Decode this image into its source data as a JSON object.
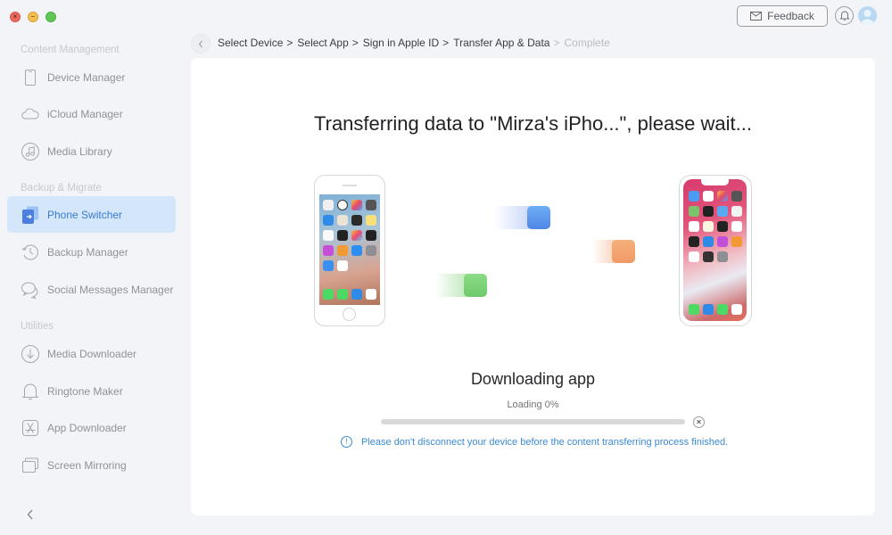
{
  "window": {
    "controls": [
      "close",
      "minimize",
      "maximize"
    ]
  },
  "header": {
    "feedback_label": "Feedback",
    "feedback_icon": "mail-icon",
    "notifications_icon": "bell-icon",
    "avatar_icon": "user-avatar-icon"
  },
  "sidebar": {
    "sections": [
      {
        "label": "Content Management",
        "items": [
          {
            "label": "Device Manager",
            "icon": "phone-icon",
            "active": false
          },
          {
            "label": "iCloud Manager",
            "icon": "cloud-icon",
            "active": false
          },
          {
            "label": "Media Library",
            "icon": "music-note-icon",
            "active": false
          }
        ]
      },
      {
        "label": "Backup & Migrate",
        "items": [
          {
            "label": "Phone Switcher",
            "icon": "phone-switch-icon",
            "active": true
          },
          {
            "label": "Backup Manager",
            "icon": "history-icon",
            "active": false
          },
          {
            "label": "Social Messages Manager",
            "icon": "chat-bubbles-icon",
            "active": false
          }
        ]
      },
      {
        "label": "Utilities",
        "items": [
          {
            "label": "Media Downloader",
            "icon": "download-circle-icon",
            "active": false
          },
          {
            "label": "Ringtone Maker",
            "icon": "bell-icon",
            "active": false
          },
          {
            "label": "App Downloader",
            "icon": "app-store-icon",
            "active": false
          },
          {
            "label": "Screen Mirroring",
            "icon": "screens-icon",
            "active": false
          }
        ]
      }
    ],
    "collapse_icon": "chevron-left-icon"
  },
  "breadcrumb": {
    "back_icon": "chevron-left-icon",
    "steps": [
      {
        "label": "Select Device",
        "done": true
      },
      {
        "label": "Select App",
        "done": true
      },
      {
        "label": "Sign in Apple ID",
        "done": true
      },
      {
        "label": "Transfer App & Data",
        "done": true
      },
      {
        "label": "Complete",
        "done": false
      }
    ],
    "separator": ">"
  },
  "main": {
    "title": "Transferring data to \"Mirza's iPho...\", please wait...",
    "source_device": "iPhone (home button)",
    "target_device": "iPhone X",
    "status_title": "Downloading app",
    "loading_text": "Loading 0%",
    "progress_percent": 0,
    "cancel_icon": "close-circle-icon",
    "warning_icon": "info-circle-icon",
    "warning_text": "Please don't disconnect your device before the content transferring process finished."
  },
  "colors": {
    "accent": "#3a7cd0",
    "active_bg": "#d3e6fa",
    "warning_text": "#3b8ad4",
    "tile_blue": "#5b94ec",
    "tile_orange": "#f2a06c",
    "tile_green": "#7fd17a"
  }
}
